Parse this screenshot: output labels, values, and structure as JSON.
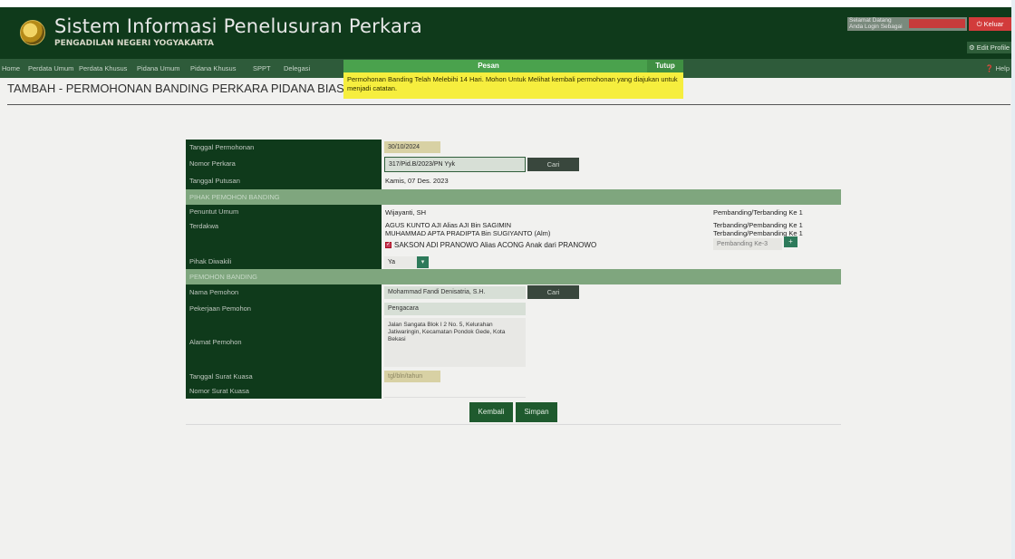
{
  "app": {
    "title": "Sistem Informasi Penelusuran Perkara",
    "subtitle": "PENGADILAN NEGERI YOGYAKARTA"
  },
  "header": {
    "welcome_line1": "Selamat Datang",
    "welcome_line2": "Anda Login Sebagai",
    "logout_label": "Keluar",
    "edit_profile_label": "Edit Profile"
  },
  "nav": {
    "items": [
      "Home",
      "Perdata Umum",
      "Perdata Khusus",
      "Pidana Umum",
      "Pidana Khusus",
      "SPPT",
      "Delegasi"
    ],
    "help_label": "Help"
  },
  "page_title": "TAMBAH - PERMOHONAN BANDING PERKARA PIDANA BIASA",
  "toast": {
    "title": "Pesan",
    "close_label": "Tutup",
    "message": "Permohonan Banding Telah Melebihi 14 Hari. Mohon Untuk Melihat kembali permohonan yang diajukan untuk menjadi catatan."
  },
  "form": {
    "tanggal_permohonan": {
      "label": "Tanggal Permohonan",
      "value": "30/10/2024"
    },
    "nomor_perkara": {
      "label": "Nomor Perkara",
      "value": "317/Pid.B/2023/PN Yyk",
      "button": "Cari"
    },
    "tanggal_putusan": {
      "label": "Tanggal Putusan",
      "value": "Kamis, 07 Des. 2023"
    },
    "section_pihak": "PIHAK PEMOHON BANDING",
    "penuntut_umum": {
      "label": "Penuntut Umum",
      "name": "Wijayanti, SH",
      "role": "Pembanding/Terbanding Ke 1"
    },
    "terdakwa": {
      "label": "Terdakwa",
      "rows": [
        {
          "name": "AGUS KUNTO AJI Alias AJI Bin SAGIMIN",
          "role": "Terbanding/Pembanding Ke 1"
        },
        {
          "name": "MUHAMMAD APTA PRADIPTA Bin SUGIYANTO (Alm)",
          "role": "Terbanding/Pembanding Ke 1"
        }
      ],
      "checked_name": "SAKSON ADI PRANOWO Alias ACONG Anak dari PRANOWO",
      "checked_role": "Pembanding Ke-3",
      "add_label": "+"
    },
    "pihak_diwakili": {
      "label": "Pihak Diwakili",
      "value": "Ya"
    },
    "section_pemohon": "PEMOHON BANDING",
    "nama_pemohon": {
      "label": "Nama Pemohon",
      "value": "Mohammad Fandi Denisatria, S.H.",
      "button": "Cari"
    },
    "pekerjaan_pemohon": {
      "label": "Pekerjaan Pemohon",
      "value": "Pengacara"
    },
    "alamat_pemohon": {
      "label": "Alamat Pemohon",
      "value": "Jalan Sangata Blok I 2 No. 5, Kelurahan Jatiwaringin, Kecamatan Pondok Gede, Kota Bekasi"
    },
    "tanggal_surat_kuasa": {
      "label": "Tanggal Surat Kuasa",
      "placeholder": "tgl/bln/tahun"
    },
    "nomor_surat_kuasa": {
      "label": "Nomor Surat Kuasa",
      "value": ""
    },
    "kembali_label": "Kembali",
    "simpan_label": "Simpan"
  }
}
